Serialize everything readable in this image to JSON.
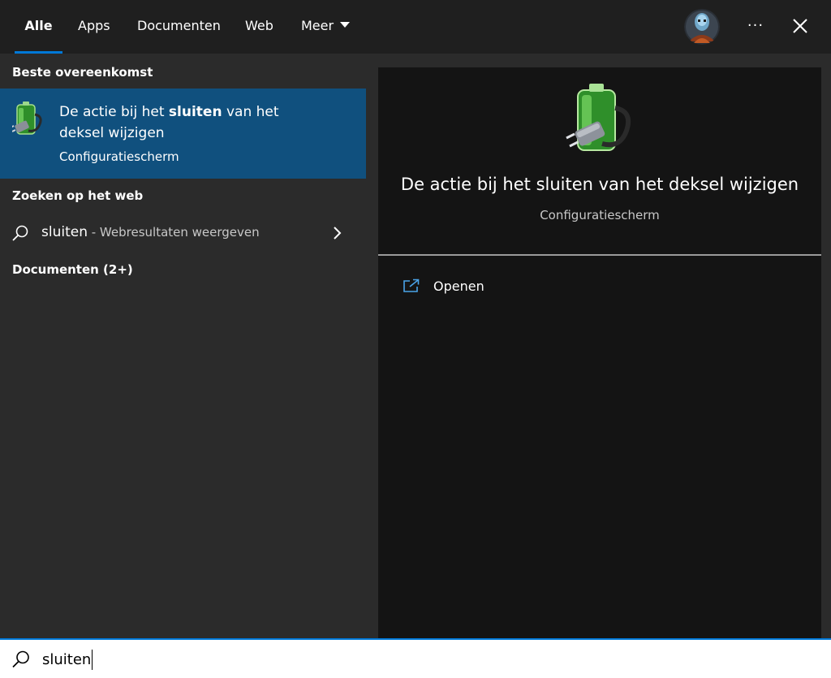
{
  "tabs": {
    "all": "Alle",
    "apps": "Apps",
    "documents": "Documenten",
    "web": "Web",
    "more": "Meer"
  },
  "toolbar": {
    "more_glyph": "···"
  },
  "left": {
    "best_match_heading": "Beste overeenkomst",
    "best_match": {
      "title_before": "De actie bij het ",
      "title_bold": "sluiten",
      "title_after": " van het deksel wijzigen",
      "subtitle": "Configuratiescherm"
    },
    "web_heading": "Zoeken op het web",
    "web_result": {
      "term": "sluiten",
      "hint": " - Webresultaten weergeven"
    },
    "documents_heading": "Documenten (2+)"
  },
  "preview": {
    "title": "De actie bij het sluiten van het deksel wijzigen",
    "subtitle": "Configuratiescherm",
    "open_label": "Openen"
  },
  "search": {
    "value": "sluiten"
  },
  "colors": {
    "accent": "#0078d7",
    "selected_row": "#10507e",
    "pane_bg": "#2b2b2b",
    "preview_bg": "#141414",
    "topbar_bg": "#1f1f1f"
  },
  "icons": {
    "battery": "battery-power-plug-icon",
    "search": "search-icon",
    "chevron": "chevron-right-icon",
    "open": "open-external-icon",
    "close": "close-icon",
    "more": "more-options-icon",
    "dropdown": "caret-down-icon"
  }
}
